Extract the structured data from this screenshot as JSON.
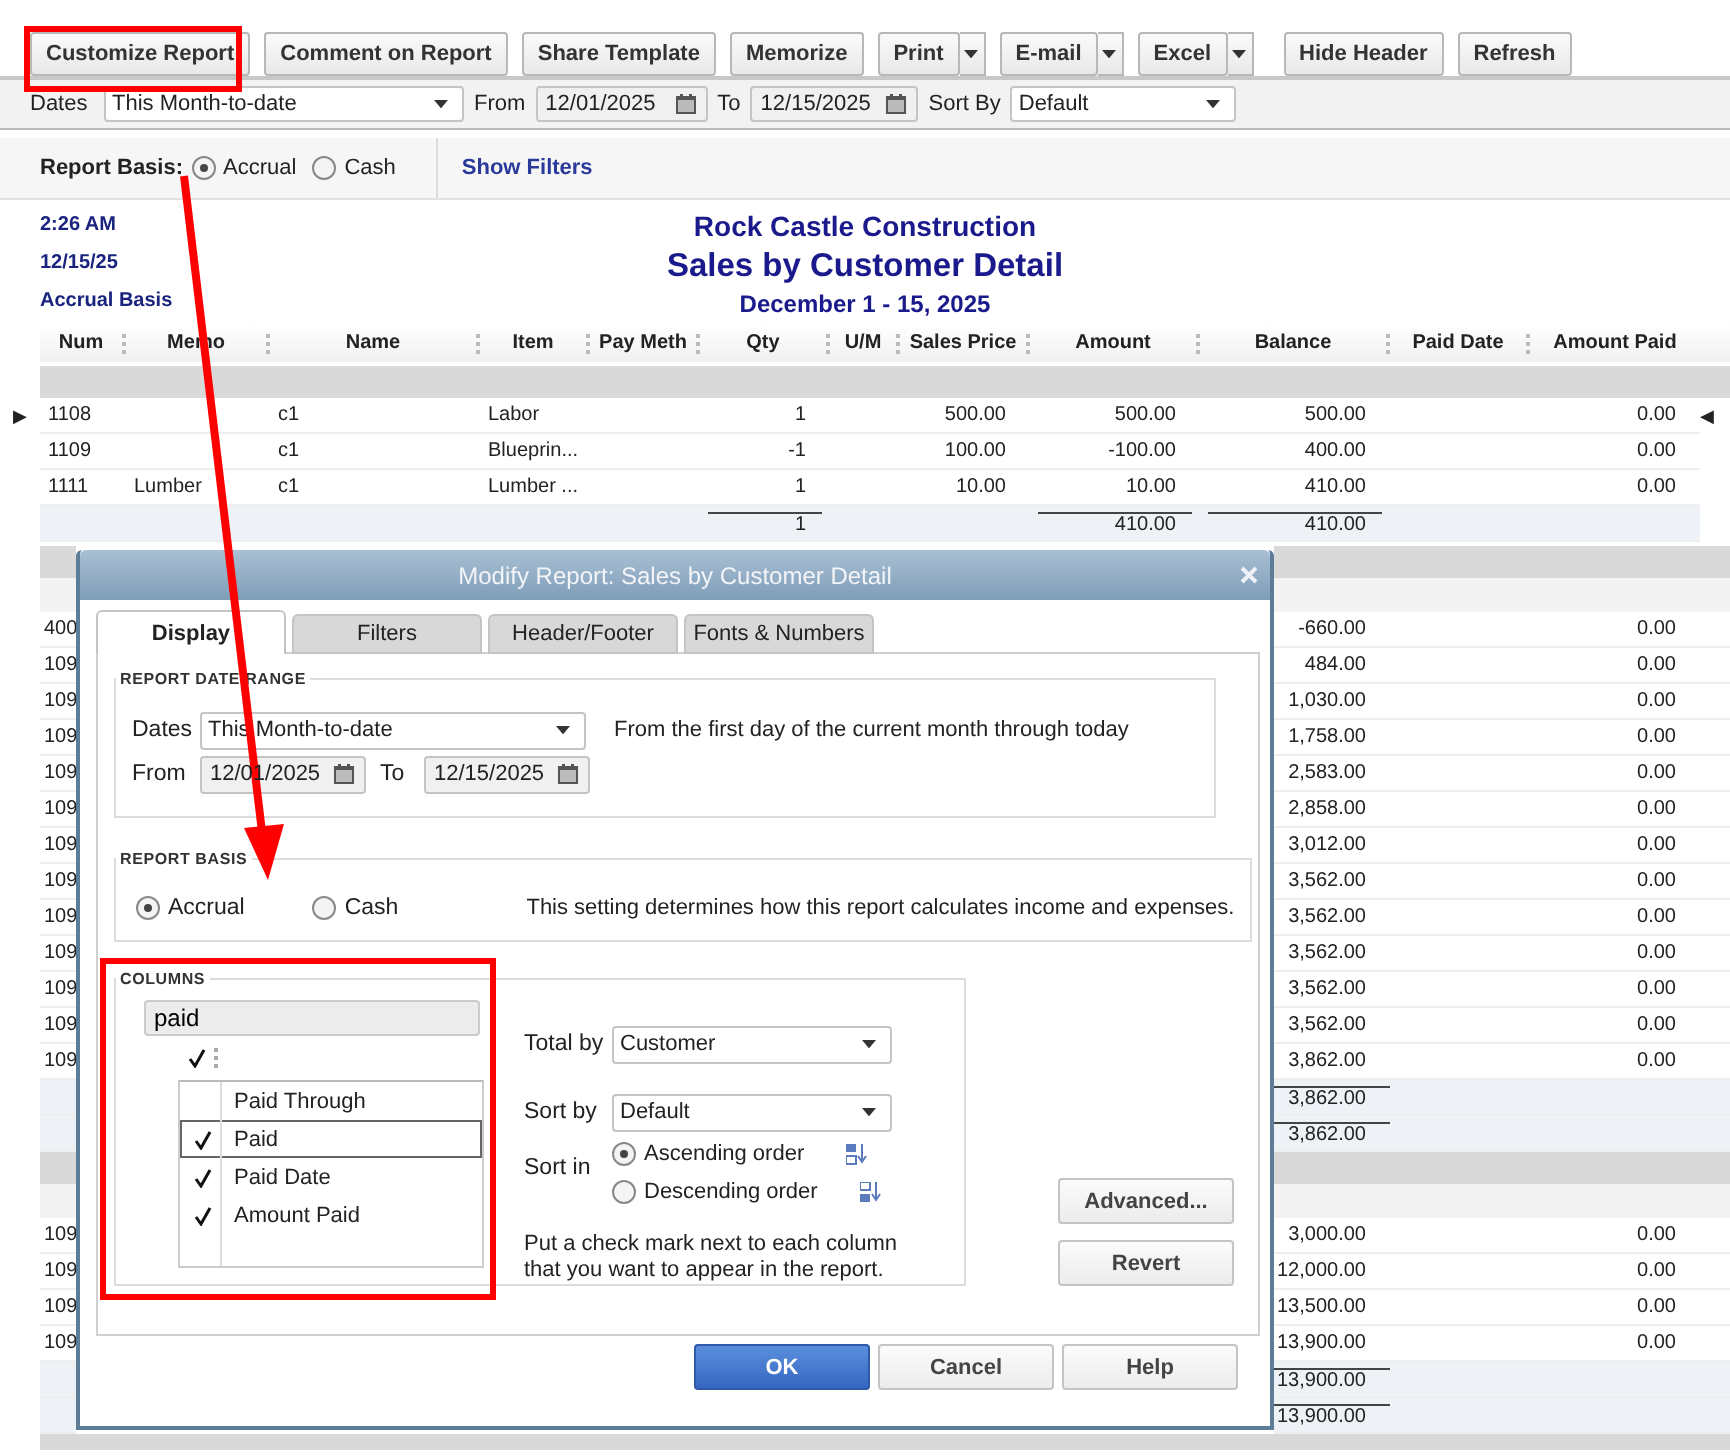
{
  "toolbar": {
    "buttons": [
      {
        "label": "Customize Report",
        "kind": "plain"
      },
      {
        "label": "Comment on Report",
        "kind": "plain"
      },
      {
        "label": "Share Template",
        "kind": "plain"
      },
      {
        "label": "Memorize",
        "kind": "plain"
      },
      {
        "label": "Print",
        "kind": "split"
      },
      {
        "label": "E-mail",
        "kind": "split"
      },
      {
        "label": "Excel",
        "kind": "split"
      },
      {
        "label": "Hide Header",
        "kind": "plain"
      },
      {
        "label": "Refresh",
        "kind": "plain"
      }
    ]
  },
  "filter_bar": {
    "dates_label": "Dates",
    "dates_value": "This Month-to-date",
    "from_label": "From",
    "from_value": "12/01/2025",
    "to_label": "To",
    "to_value": "12/15/2025",
    "sort_label": "Sort By",
    "sort_value": "Default"
  },
  "basis_bar": {
    "label": "Report Basis:",
    "options": [
      {
        "label": "Accrual",
        "selected": true
      },
      {
        "label": "Cash",
        "selected": false
      }
    ],
    "filters_link": "Show Filters"
  },
  "report": {
    "time": "2:26 AM",
    "date": "12/15/25",
    "basis": "Accrual Basis",
    "company": "Rock Castle Construction",
    "title": "Sales by Customer Detail",
    "period": "December 1 - 15, 2025",
    "columns": [
      "Num",
      "Memo",
      "Name",
      "Item",
      "Pay Meth",
      "Qty",
      "U/M",
      "Sales Price",
      "Amount",
      "Balance",
      "Paid Date",
      "Amount Paid"
    ],
    "top_rows": [
      {
        "kind": "band"
      },
      {
        "kind": "data",
        "marker_left": "▶",
        "marker_right": "◀",
        "num": "1108",
        "name": "c1",
        "item": "Labor",
        "qty": "1",
        "sales_price": "500.00",
        "amount": "500.00",
        "balance": "500.00",
        "amount_paid": "0.00"
      },
      {
        "kind": "data",
        "num": "1109",
        "name": "c1",
        "item": "Blueprin...",
        "qty": "-1",
        "sales_price": "100.00",
        "amount": "-100.00",
        "balance": "400.00",
        "amount_paid": "0.00"
      },
      {
        "kind": "data",
        "num": "1111",
        "memo": "Lumber",
        "name": "c1",
        "item": "Lumber ...",
        "qty": "1",
        "sales_price": "10.00",
        "amount": "10.00",
        "balance": "410.00",
        "amount_paid": "0.00"
      },
      {
        "kind": "total",
        "qty": "1",
        "amount": "410.00",
        "balance": "410.00"
      }
    ],
    "lower_rows": [
      {
        "kind": "band"
      },
      {
        "kind": "subband"
      },
      {
        "kind": "data",
        "num": "400",
        "balance": "-660.00",
        "amount_paid": "0.00"
      },
      {
        "kind": "data",
        "num": "109",
        "balance": "484.00",
        "amount_paid": "0.00"
      },
      {
        "kind": "data",
        "num": "109",
        "balance": "1,030.00",
        "amount_paid": "0.00"
      },
      {
        "kind": "data",
        "num": "109",
        "balance": "1,758.00",
        "amount_paid": "0.00"
      },
      {
        "kind": "data",
        "num": "109",
        "balance": "2,583.00",
        "amount_paid": "0.00"
      },
      {
        "kind": "data",
        "num": "109",
        "balance": "2,858.00",
        "amount_paid": "0.00"
      },
      {
        "kind": "data",
        "num": "109",
        "balance": "3,012.00",
        "amount_paid": "0.00"
      },
      {
        "kind": "data",
        "num": "109",
        "balance": "3,562.00",
        "amount_paid": "0.00"
      },
      {
        "kind": "data",
        "num": "109",
        "balance": "3,562.00",
        "amount_paid": "0.00"
      },
      {
        "kind": "data",
        "num": "109",
        "balance": "3,562.00",
        "amount_paid": "0.00"
      },
      {
        "kind": "data",
        "num": "109",
        "balance": "3,562.00",
        "amount_paid": "0.00"
      },
      {
        "kind": "data",
        "num": "109",
        "balance": "3,562.00",
        "amount_paid": "0.00"
      },
      {
        "kind": "data",
        "num": "109",
        "balance": "3,862.00",
        "amount_paid": "0.00"
      },
      {
        "kind": "total",
        "balance": "3,862.00"
      },
      {
        "kind": "total",
        "balance": "3,862.00"
      },
      {
        "kind": "band"
      },
      {
        "kind": "subband"
      },
      {
        "kind": "data",
        "num": "109",
        "balance": "3,000.00",
        "amount_paid": "0.00"
      },
      {
        "kind": "data",
        "num": "109",
        "balance": "12,000.00",
        "amount_paid": "0.00"
      },
      {
        "kind": "data",
        "num": "109",
        "balance": "13,500.00",
        "amount_paid": "0.00"
      },
      {
        "kind": "data",
        "num": "109",
        "balance": "13,900.00",
        "amount_paid": "0.00"
      },
      {
        "kind": "total",
        "balance": "13,900.00"
      },
      {
        "kind": "total",
        "balance": "13,900.00"
      }
    ]
  },
  "dialog": {
    "title": "Modify Report: Sales by Customer Detail",
    "tabs": [
      {
        "label": "Display",
        "selected": true
      },
      {
        "label": "Filters",
        "selected": false
      },
      {
        "label": "Header/Footer",
        "selected": false
      },
      {
        "label": "Fonts & Numbers",
        "selected": false
      }
    ],
    "date_range": {
      "heading": "REPORT DATE RANGE",
      "dates_label": "Dates",
      "dates_value": "This Month-to-date",
      "description": "From the first day of the current month through today",
      "from_label": "From",
      "from_value": "12/01/2025",
      "to_label": "To",
      "to_value": "12/15/2025"
    },
    "basis": {
      "heading": "REPORT BASIS",
      "options": [
        {
          "label": "Accrual",
          "selected": true
        },
        {
          "label": "Cash",
          "selected": false
        }
      ],
      "description": "This setting determines how this report calculates income and expenses."
    },
    "columns": {
      "heading": "COLUMNS",
      "search_value": "paid",
      "items": [
        {
          "label": "Paid Through",
          "checked": false,
          "selected": false
        },
        {
          "label": "Paid",
          "checked": true,
          "selected": true
        },
        {
          "label": "Paid Date",
          "checked": true,
          "selected": false
        },
        {
          "label": "Amount Paid",
          "checked": true,
          "selected": false
        }
      ],
      "total_by_label": "Total by",
      "total_by_value": "Customer",
      "sort_by_label": "Sort by",
      "sort_by_value": "Default",
      "sort_in_label": "Sort in",
      "sort_options": [
        {
          "label": "Ascending order",
          "selected": true
        },
        {
          "label": "Descending order",
          "selected": false
        }
      ],
      "hint": "Put a check mark next to each column that you want to appear in the report."
    },
    "side_buttons": [
      "Advanced...",
      "Revert"
    ],
    "buttons": [
      {
        "label": "OK",
        "kind": "primary"
      },
      {
        "label": "Cancel",
        "kind": "normal"
      },
      {
        "label": "Help",
        "kind": "normal"
      }
    ]
  }
}
